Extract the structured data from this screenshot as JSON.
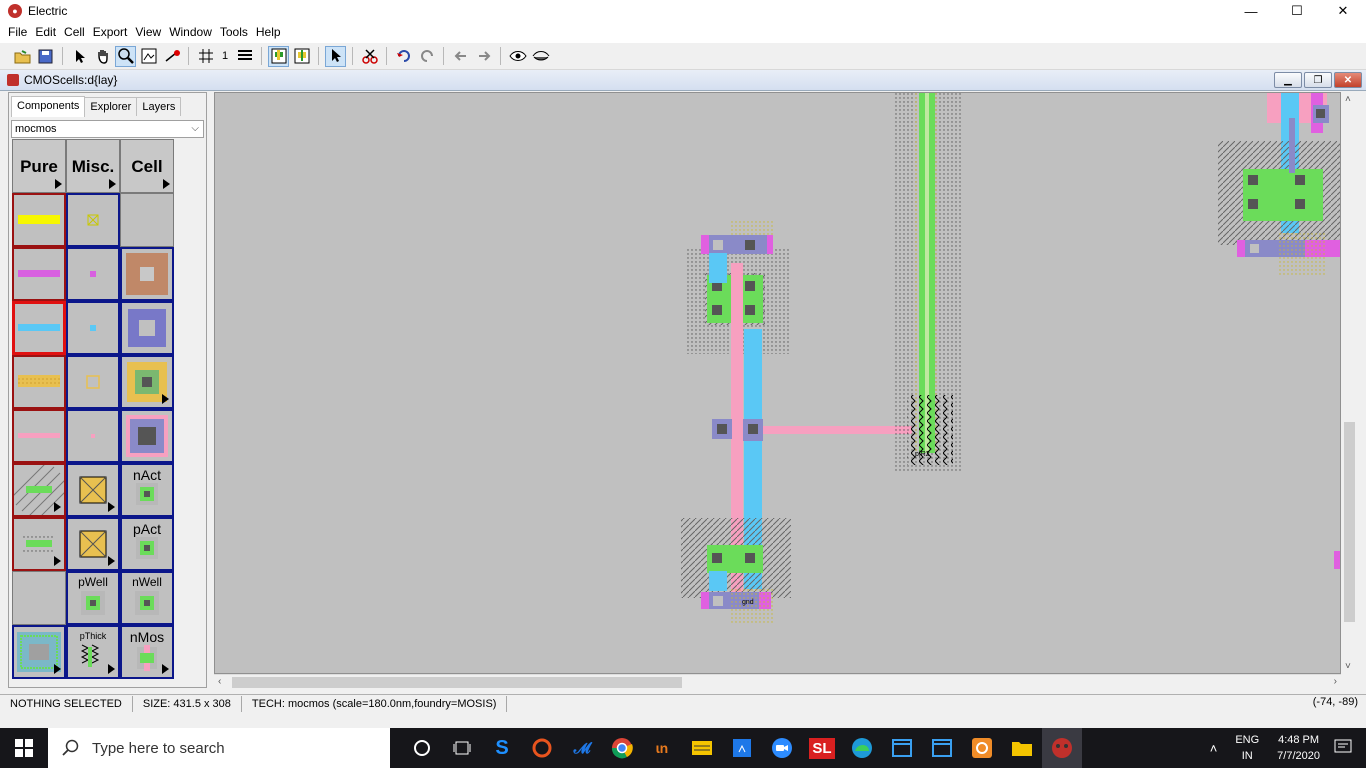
{
  "window": {
    "title": "Electric",
    "min": "—",
    "max": "☐",
    "close": "✕"
  },
  "menu": [
    "File",
    "Edit",
    "Cell",
    "Export",
    "View",
    "Window",
    "Tools",
    "Help"
  ],
  "toolbar": {
    "grid_value": "1"
  },
  "inner_window": {
    "title": "CMOScells:d{lay}"
  },
  "panel": {
    "tabs": [
      "Components",
      "Explorer",
      "Layers"
    ],
    "technology": "mocmos",
    "headers": [
      "Pure",
      "Misc.",
      "Cell"
    ],
    "labels": {
      "nact": "nAct",
      "pact": "pAct",
      "pwell": "pWell",
      "nwell": "nWell",
      "pthick": "pThick",
      "nmos": "nMos"
    }
  },
  "canvas": {
    "labels": {
      "gnd": "gnd",
      "ptr2": "p|R2"
    }
  },
  "status": {
    "selection": "NOTHING SELECTED",
    "size": "SIZE: 431.5 x 308",
    "tech": "TECH: mocmos (scale=180.0nm,foundry=MOSIS)",
    "coords": "(-74, -89)"
  },
  "taskbar": {
    "search_placeholder": "Type here to search",
    "lang": "ENG",
    "region": "IN",
    "time": "4:48 PM",
    "date": "7/7/2020",
    "sl_label": "SL"
  },
  "colors": {
    "metal1": "#5ac8f5",
    "metal2": "#e060e0",
    "poly": "#f7a0c0",
    "active": "#6bdc5a",
    "contact": "#8a8ac8",
    "background": "#c0c0c0"
  }
}
